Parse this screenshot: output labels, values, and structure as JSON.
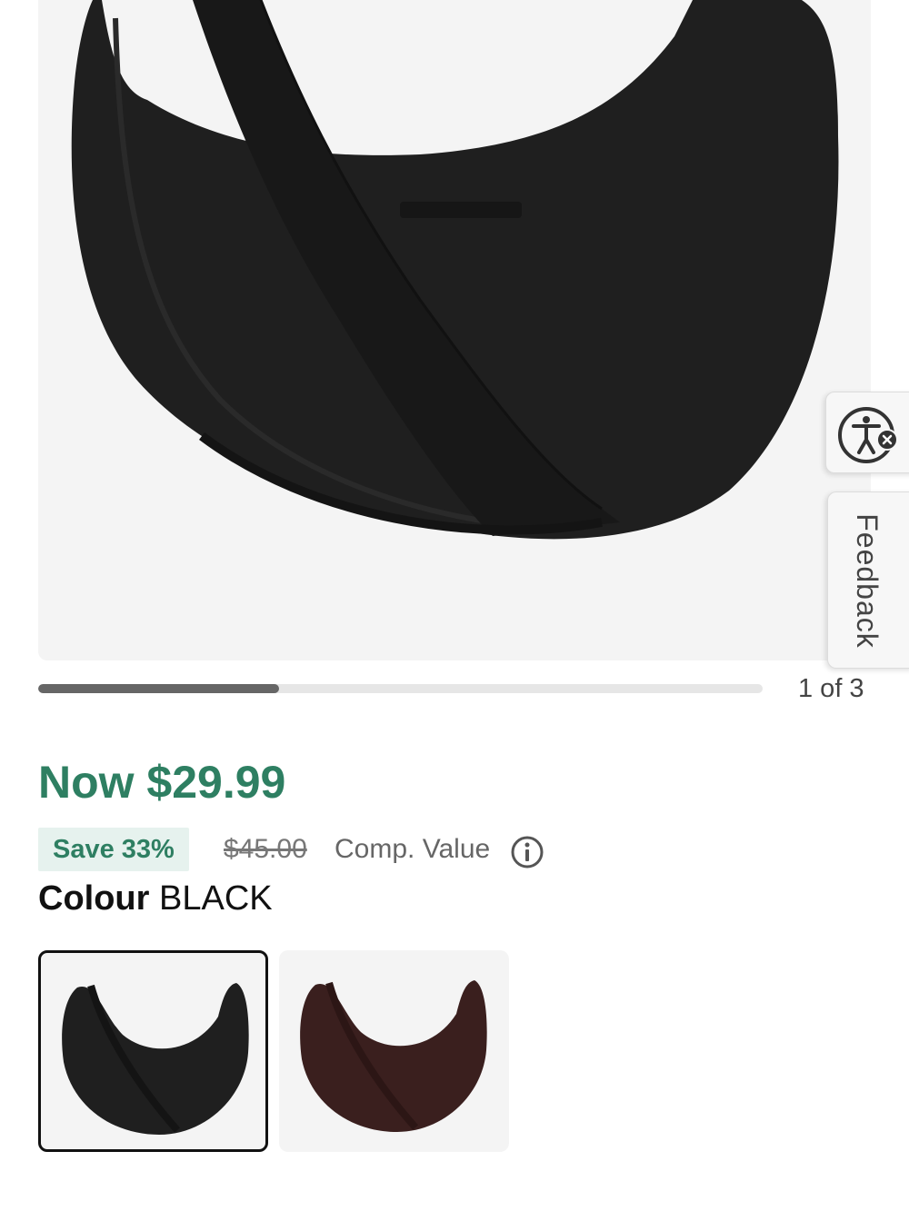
{
  "gallery": {
    "progress_fraction": 0.333,
    "page_indicator": "1 of 3"
  },
  "side_widgets": {
    "accessibility_icon": "accessibility-icon",
    "feedback_label": "Feedback"
  },
  "price": {
    "now": "Now $29.99",
    "save_badge": "Save 33%",
    "comp_value": "$45.00",
    "comp_label": "Comp. Value",
    "info_icon": "info-icon"
  },
  "colour": {
    "label": "Colour",
    "value": "BLACK",
    "swatches": [
      {
        "name": "black",
        "color": "#1f1f1f",
        "selected": true
      },
      {
        "name": "brown",
        "color": "#3a1f1e",
        "selected": false
      }
    ]
  },
  "colors": {
    "accent_green": "#2e7f62",
    "badge_bg": "#e6f2ee"
  }
}
